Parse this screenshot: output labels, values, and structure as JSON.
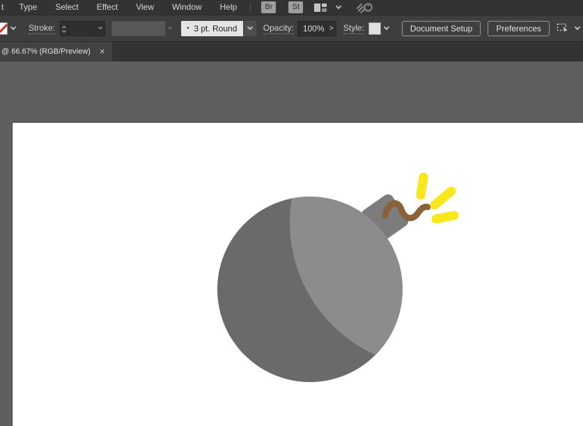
{
  "menubar": {
    "items": [
      "t",
      "Type",
      "Select",
      "Effect",
      "View",
      "Window",
      "Help"
    ],
    "bridge_button": "Br",
    "stock_button": "St"
  },
  "controlbar": {
    "stroke_label": "Stroke:",
    "brush_thumbnail": "•",
    "brush_value": "3 pt. Round",
    "opacity_label": "Opacity:",
    "opacity_value": "100%",
    "more_button": ">",
    "style_label": "Style:",
    "document_setup_button": "Document Setup",
    "preferences_button": "Preferences"
  },
  "tabbar": {
    "active_tab": "@ 66.67% (RGB/Preview)",
    "close_glyph": "×"
  },
  "artwork": {
    "description": "flat bomb icon with lit fuse and yellow sparks",
    "artboard_color": "#ffffff",
    "body_color": "#6a6a6a",
    "highlight_color": "#8c8c8c",
    "cap_color": "#7c7c7c",
    "fuse_color": "#8a6239",
    "spark_color": "#f7e71c"
  },
  "colors": {
    "menubar_bg": "#333333",
    "controlbar_bg": "#3e3e3e",
    "field_bg": "#2f2f2f",
    "tab_active_bg": "#424242",
    "pasteboard": "#5f5f5f",
    "swatch_none_slash": "#cf2b24"
  }
}
